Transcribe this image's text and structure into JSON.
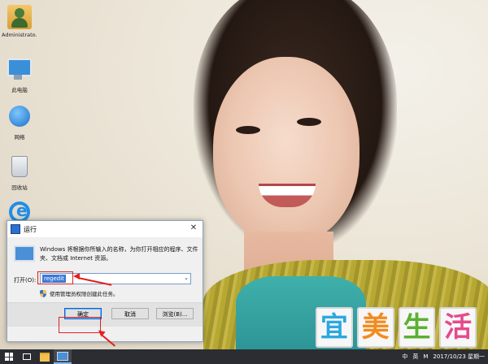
{
  "desktop": {
    "icons": [
      {
        "label": "Administrato..."
      },
      {
        "label": "此电脑"
      },
      {
        "label": "网络"
      },
      {
        "label": "回收站"
      },
      {
        "label": ""
      }
    ]
  },
  "run_dialog": {
    "title": "运行",
    "close_glyph": "✕",
    "description": "Windows 将根据你所输入的名称，为你打开相应的程序、文件夹、文档或 Internet 资源。",
    "open_label": "打开(O):",
    "open_value": "regedit",
    "dropdown_glyph": "⌄",
    "admin_note": "使用管理员权限创建此任务。",
    "buttons": {
      "ok": "确定",
      "cancel": "取消",
      "browse": "浏览(B)..."
    }
  },
  "watermark": {
    "chars": [
      "宜",
      "美",
      "生",
      "活"
    ],
    "colors": [
      "#2aa8e0",
      "#f28b1f",
      "#5bb031",
      "#e44a8c"
    ]
  },
  "taskbar": {
    "tray": {
      "ime": "中",
      "lang": "英",
      "app": "M",
      "datetime": "2017/10/23 星期一"
    }
  },
  "colors": {
    "annotation": "#e02020",
    "selection": "#3b79d6",
    "taskbar": "#2b2d33"
  }
}
